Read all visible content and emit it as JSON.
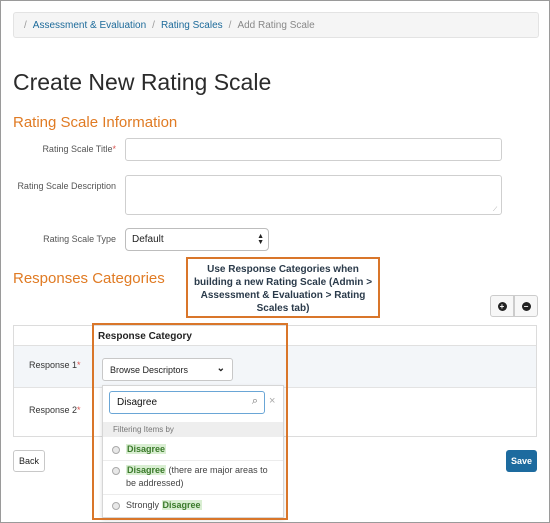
{
  "breadcrumb": {
    "items": [
      "Assessment & Evaluation",
      "Rating Scales"
    ],
    "current": "Add Rating Scale"
  },
  "page_title": "Create New Rating Scale",
  "info_section": {
    "title": "Rating Scale Information",
    "title_label": "Rating Scale Title",
    "title_value": "",
    "description_label": "Rating Scale Description",
    "description_value": "",
    "type_label": "Rating Scale Type",
    "type_value": "Default"
  },
  "responses_section": {
    "title": "Responses Categories",
    "annotation": "Use Response Categories when building a new Rating Scale (Admin > Assessment & Evaluation > Rating Scales tab)",
    "add_icon": "plus-circle-icon",
    "remove_icon": "minus-circle-icon",
    "column_header": "Response Category",
    "rows": [
      {
        "label": "Response 1"
      },
      {
        "label": "Response 2"
      }
    ],
    "browse_label": "Browse Descriptors",
    "search_value": "Disagree",
    "filter_label": "Filtering Items by",
    "options": [
      {
        "highlight": "Disagree",
        "rest": ""
      },
      {
        "highlight": "Disagree",
        "rest": " (there are major areas to be addressed)"
      },
      {
        "prefix": "Strongly ",
        "highlight": "Disagree",
        "rest": ""
      }
    ]
  },
  "footer": {
    "back_label": "Back",
    "save_label": "Save"
  },
  "colors": {
    "accent_orange": "#e07b24",
    "link_blue": "#1c6a9a",
    "save_blue": "#1d6b9f",
    "highlight_green": "#d9eed2"
  }
}
